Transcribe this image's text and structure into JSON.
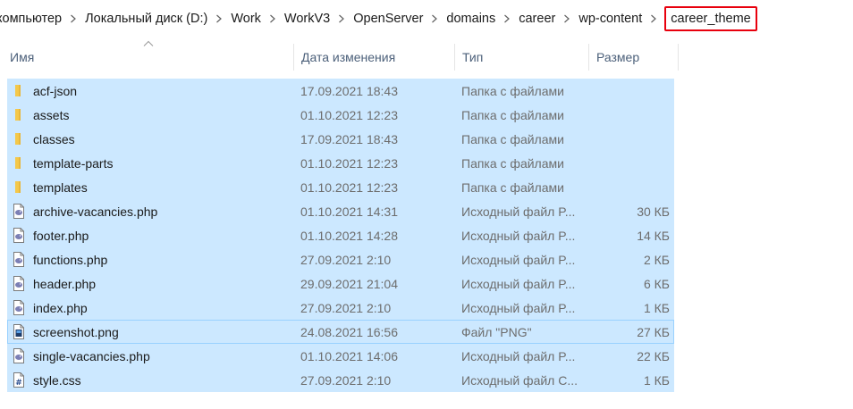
{
  "breadcrumb": {
    "items": [
      {
        "label": "компьютер"
      },
      {
        "label": "Локальный диск (D:)"
      },
      {
        "label": "Work"
      },
      {
        "label": "WorkV3"
      },
      {
        "label": "OpenServer"
      },
      {
        "label": "domains"
      },
      {
        "label": "career"
      },
      {
        "label": "wp-content"
      },
      {
        "label": "career_theme",
        "highlighted": true
      }
    ],
    "highlight_color": "#e8000d"
  },
  "columns": {
    "name": "Имя",
    "date": "Дата изменения",
    "type": "Тип",
    "size": "Размер",
    "sort_column": "name"
  },
  "selection_color": "#cce8ff",
  "files": [
    {
      "name": "acf-json",
      "date": "17.09.2021 18:43",
      "type": "Папка с файлами",
      "size": "",
      "icon": "folder-icon"
    },
    {
      "name": "assets",
      "date": "01.10.2021 12:23",
      "type": "Папка с файлами",
      "size": "",
      "icon": "folder-icon"
    },
    {
      "name": "classes",
      "date": "17.09.2021 18:43",
      "type": "Папка с файлами",
      "size": "",
      "icon": "folder-icon"
    },
    {
      "name": "template-parts",
      "date": "01.10.2021 12:23",
      "type": "Папка с файлами",
      "size": "",
      "icon": "folder-icon"
    },
    {
      "name": "templates",
      "date": "01.10.2021 12:23",
      "type": "Папка с файлами",
      "size": "",
      "icon": "folder-icon"
    },
    {
      "name": "archive-vacancies.php",
      "date": "01.10.2021 14:31",
      "type": "Исходный файл P...",
      "size": "30 КБ",
      "icon": "php-file-icon"
    },
    {
      "name": "footer.php",
      "date": "01.10.2021 14:28",
      "type": "Исходный файл P...",
      "size": "14 КБ",
      "icon": "php-file-icon"
    },
    {
      "name": "functions.php",
      "date": "27.09.2021 2:10",
      "type": "Исходный файл P...",
      "size": "2 КБ",
      "icon": "php-file-icon"
    },
    {
      "name": "header.php",
      "date": "29.09.2021 21:04",
      "type": "Исходный файл P...",
      "size": "6 КБ",
      "icon": "php-file-icon"
    },
    {
      "name": "index.php",
      "date": "27.09.2021 2:10",
      "type": "Исходный файл P...",
      "size": "1 КБ",
      "icon": "php-file-icon"
    },
    {
      "name": "screenshot.png",
      "date": "24.08.2021 16:56",
      "type": "Файл \"PNG\"",
      "size": "27 КБ",
      "icon": "image-file-icon",
      "focused": true
    },
    {
      "name": "single-vacancies.php",
      "date": "01.10.2021 14:06",
      "type": "Исходный файл P...",
      "size": "22 КБ",
      "icon": "php-file-icon"
    },
    {
      "name": "style.css",
      "date": "27.09.2021 2:10",
      "type": "Исходный файл C...",
      "size": "1 КБ",
      "icon": "css-file-icon"
    }
  ]
}
